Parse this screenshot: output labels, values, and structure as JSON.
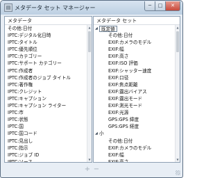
{
  "window": {
    "title": "メタデータ セット マネージャー",
    "app_icon_glyph": "▤",
    "minimize_glyph": "─",
    "maximize_glyph": "□",
    "close_glyph": "✕"
  },
  "left_panel": {
    "header": "メタデータ",
    "items": [
      "その他:日付",
      "IPTC:デジタル化日時",
      "IPTC:タイトル",
      "IPTC:優先順位",
      "IPTC:カテゴリー",
      "IPTC:サポート カテゴリー",
      "IPTC:作成者",
      "IPTC:作成者のジョブ タイトル",
      "IPTC:著作権",
      "IPTC:クレジット",
      "IPTC:キャプション",
      "IPTC:キャプション ライター",
      "IPTC:市",
      "IPTC:状態",
      "IPTC:国",
      "IPTC:国コード",
      "IPTC:見出し",
      "IPTC:指示",
      "IPTC:ジョブ ID",
      "IPTC:ソース"
    ]
  },
  "right_panel": {
    "header": "メタデータ セット",
    "rows": [
      {
        "type": "group",
        "label": "既定値",
        "expand_glyph": "◢",
        "selected": true
      },
      {
        "type": "item",
        "label": "その他:日付"
      },
      {
        "type": "item",
        "label": "EXIF:カメラのモデル"
      },
      {
        "type": "item",
        "label": "EXIF:幅"
      },
      {
        "type": "item",
        "label": "EXIF:高さ"
      },
      {
        "type": "item",
        "label": "EXIF:ISO 評価"
      },
      {
        "type": "item",
        "label": "EXIF:シャッター速度"
      },
      {
        "type": "item",
        "label": "EXIF:口径"
      },
      {
        "type": "item",
        "label": "EXIF:焦点距離"
      },
      {
        "type": "item",
        "label": "EXIF:露出バイアス"
      },
      {
        "type": "item",
        "label": "EXIF:露出モード"
      },
      {
        "type": "item",
        "label": "EXIF:測光モード"
      },
      {
        "type": "item",
        "label": "EXIF:光源"
      },
      {
        "type": "item",
        "label": "GPS:GPS 緯度"
      },
      {
        "type": "item",
        "label": "GPS:GPS 経度"
      },
      {
        "type": "group",
        "label": "小",
        "expand_glyph": "◢",
        "selected": false
      },
      {
        "type": "item",
        "label": "その他:日付"
      },
      {
        "type": "item",
        "label": "EXIF:カメラのモデル"
      },
      {
        "type": "item",
        "label": "EXIF:幅"
      },
      {
        "type": "item",
        "label": "EXIF:高さ"
      }
    ]
  },
  "scrollbar": {
    "up_glyph": "▲",
    "down_glyph": "▼"
  },
  "toolbar": {
    "add_glyph": "+",
    "remove_glyph": "−"
  }
}
